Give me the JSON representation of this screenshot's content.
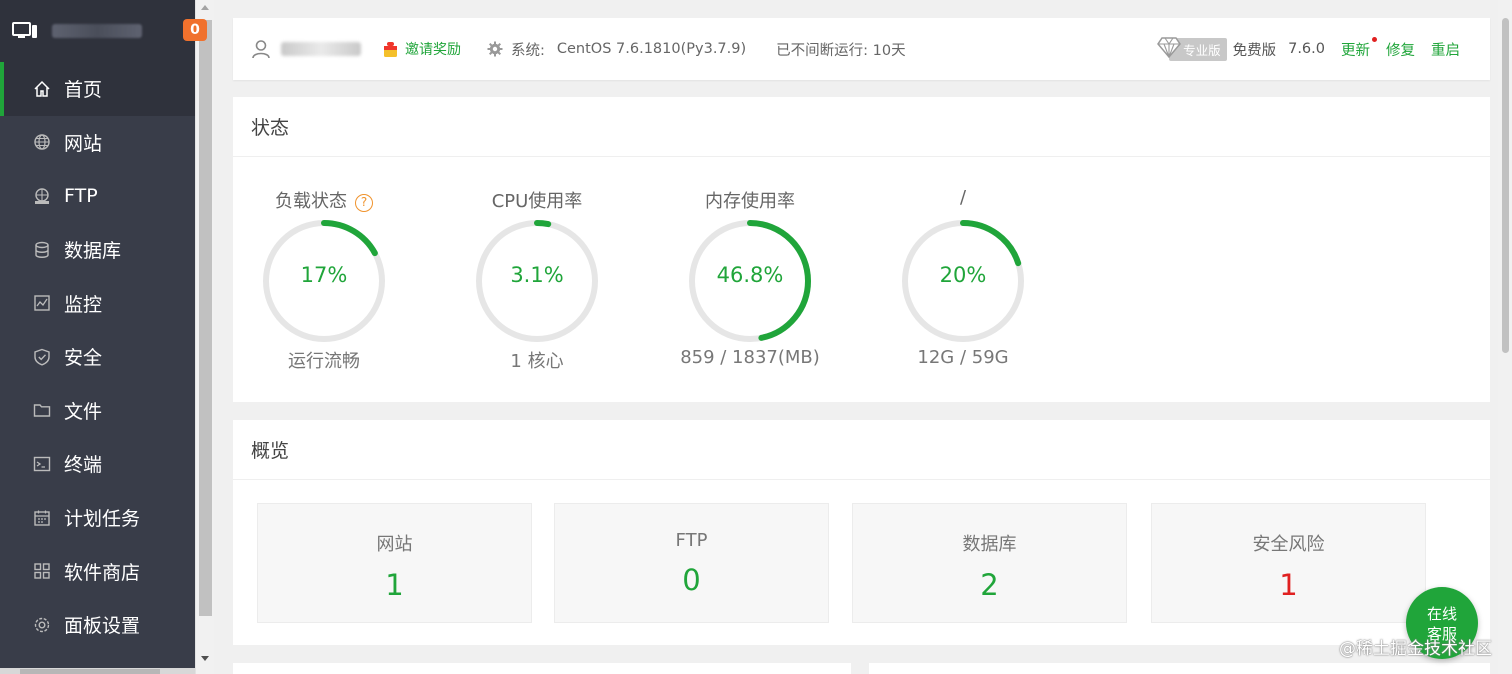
{
  "sidebar": {
    "badge_count": "0",
    "items": [
      {
        "label": "首页",
        "icon": "home-icon",
        "active": true
      },
      {
        "label": "网站",
        "icon": "globe-icon"
      },
      {
        "label": "FTP",
        "icon": "ftp-icon"
      },
      {
        "label": "数据库",
        "icon": "database-icon"
      },
      {
        "label": "监控",
        "icon": "monitor-icon"
      },
      {
        "label": "安全",
        "icon": "shield-icon"
      },
      {
        "label": "文件",
        "icon": "folder-icon"
      },
      {
        "label": "终端",
        "icon": "terminal-icon"
      },
      {
        "label": "计划任务",
        "icon": "calendar-icon"
      },
      {
        "label": "软件商店",
        "icon": "grid-icon"
      },
      {
        "label": "面板设置",
        "icon": "settings-icon"
      }
    ]
  },
  "topbar": {
    "invite": "邀请奖励",
    "system_label": "系统:",
    "system_value": "CentOS 7.6.1810(Py3.7.9)",
    "uptime": "已不间断运行: 10天",
    "pro_label": "专业版",
    "free_label": "免费版",
    "version": "7.6.0",
    "update": "更新",
    "repair": "修复",
    "restart": "重启"
  },
  "status": {
    "title": "状态",
    "gauges": [
      {
        "label": "负载状态",
        "value": "17%",
        "percent": 17,
        "sub": "运行流畅",
        "help": "?"
      },
      {
        "label": "CPU使用率",
        "value": "3.1%",
        "percent": 3.1,
        "sub": "1 核心"
      },
      {
        "label": "内存使用率",
        "value": "46.8%",
        "percent": 46.8,
        "sub": "859 / 1837(MB)"
      },
      {
        "label": "/",
        "value": "20%",
        "percent": 20,
        "sub": "12G / 59G"
      }
    ]
  },
  "overview": {
    "title": "概览",
    "cards": [
      {
        "title": "网站",
        "value": "1"
      },
      {
        "title": "FTP",
        "value": "0"
      },
      {
        "title": "数据库",
        "value": "2"
      },
      {
        "title": "安全风险",
        "value": "1"
      }
    ]
  },
  "service_button": {
    "line1": "在线",
    "line2": "客服"
  },
  "watermark": "@稀土掘金技术社区",
  "colors": {
    "accent": "#20a53a",
    "danger": "#e02020",
    "sidebar": "#393d49",
    "sidebar_active": "#2f323c",
    "badge": "#f0712d",
    "help": "#f0932d"
  }
}
